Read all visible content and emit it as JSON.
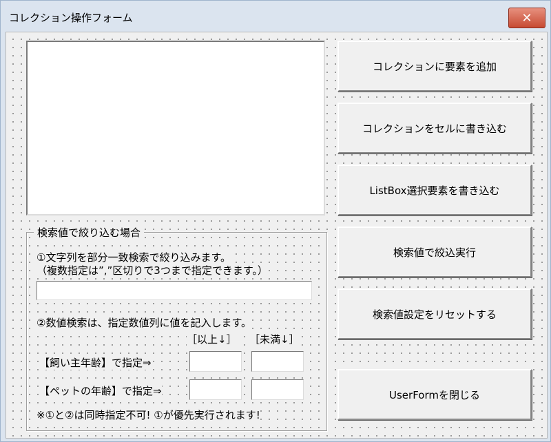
{
  "window": {
    "title": "コレクション操作フォーム",
    "close_symbol": "✕"
  },
  "buttons": {
    "add": "コレクションに要素を追加",
    "write_cells": "コレクションをセルに書き込む",
    "write_listbox": "ListBox選択要素を書き込む",
    "filter": "検索値で絞込実行",
    "reset": "検索値設定をリセットする",
    "close": "UserFormを閉じる"
  },
  "filter_frame": {
    "caption": "検索値で絞り込む場合",
    "text_search_line1": "①文字列を部分一致検索で絞り込みます。",
    "text_search_line2": "（複数指定は”,”区切りで3つまで指定できます。）",
    "text_search_value": "",
    "numeric_search": "②数値検索は、指定数値列に値を記入します。",
    "header_min": "［以上↓］",
    "header_max": "［未満↓］",
    "owner_age_label": "【飼い主年齢】で指定⇒",
    "pet_age_label": "【ペットの年齢】で指定⇒",
    "owner_age_min": "",
    "owner_age_max": "",
    "pet_age_min": "",
    "pet_age_max": "",
    "note": "※①と②は同時指定不可! ①が優先実行されます!"
  },
  "icons": {
    "close": "close-icon"
  },
  "colors": {
    "title_bg": "#dbe4ef",
    "close_btn": "#c74a32",
    "form_bg": "#f0f0f0"
  }
}
